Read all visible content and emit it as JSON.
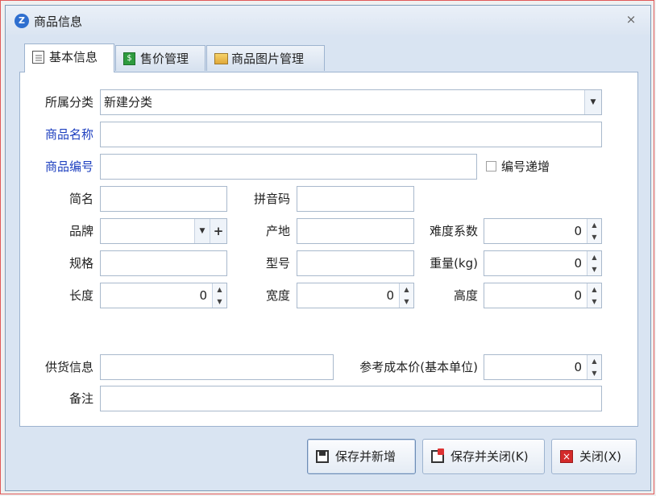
{
  "window": {
    "title": "商品信息",
    "app_icon": "Z",
    "close_label": "⨯"
  },
  "tabs": [
    {
      "label": "基本信息",
      "icon": "document-icon"
    },
    {
      "label": "售价管理",
      "icon": "money-icon"
    },
    {
      "label": "商品图片管理",
      "icon": "picture-icon"
    }
  ],
  "form": {
    "category": {
      "label": "所属分类",
      "value": "新建分类"
    },
    "name": {
      "label": "商品名称",
      "value": ""
    },
    "code": {
      "label": "商品编号",
      "value": "",
      "auto_increment_label": "编号递增"
    },
    "short_name": {
      "label": "简名",
      "value": ""
    },
    "pinyin": {
      "label": "拼音码",
      "value": ""
    },
    "brand": {
      "label": "品牌",
      "value": "",
      "add_label": "+"
    },
    "origin": {
      "label": "产地",
      "value": ""
    },
    "difficulty": {
      "label": "难度系数",
      "value": "0"
    },
    "spec": {
      "label": "规格",
      "value": ""
    },
    "model": {
      "label": "型号",
      "value": ""
    },
    "weight": {
      "label": "重量(kg)",
      "value": "0"
    },
    "length": {
      "label": "长度",
      "value": "0"
    },
    "width": {
      "label": "宽度",
      "value": "0"
    },
    "height": {
      "label": "高度",
      "value": "0"
    },
    "supplier": {
      "label": "供货信息",
      "value": ""
    },
    "ref_cost": {
      "label": "参考成本价(基本单位)",
      "value": "0"
    },
    "remark": {
      "label": "备注",
      "value": ""
    }
  },
  "buttons": {
    "save_new": "保存并新增",
    "save_close": "保存并关闭(K)",
    "close": "关闭(X)"
  },
  "colors": {
    "required_label": "#1d3fbf",
    "accent": "#2f6fcf"
  }
}
